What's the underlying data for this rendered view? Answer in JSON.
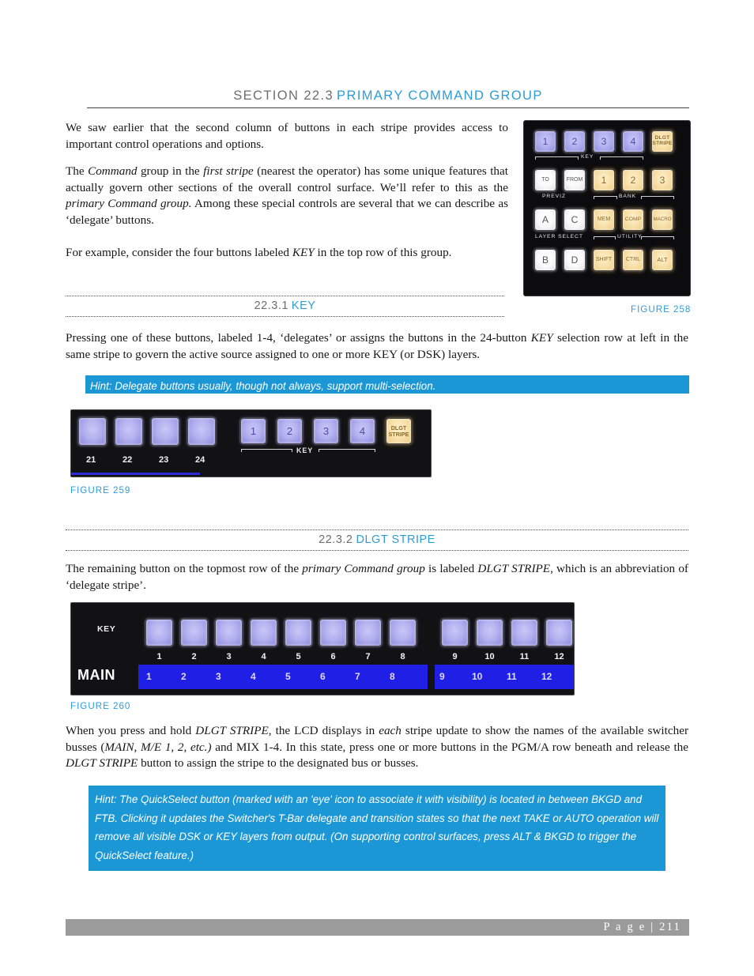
{
  "header": {
    "section_number": "SECTION 22.3",
    "section_title": "PRIMARY COMMAND GROUP"
  },
  "paragraphs": {
    "p1": "We saw earlier that the second column of buttons in each stripe provides access to important control operations and options.",
    "p2_a": "The ",
    "p2_i1": "Command",
    "p2_b": " group in the ",
    "p2_i2": "first stripe",
    "p2_c": " (nearest the operator) has some unique features that actually govern other sections of the overall control surface. We’ll refer to this as the ",
    "p2_i3": "primary Command group.",
    "p2_d": " Among these special controls are several that we can describe as ‘delegate’ buttons.",
    "p3_a": "For example, consider the four buttons labeled ",
    "p3_i1": "KEY",
    "p3_b": " in the top row of this group.",
    "p4_a": "Pressing one of these buttons, labeled 1-4, ‘delegates’ or assigns the buttons in the 24-button ",
    "p4_i1": "KEY",
    "p4_b": " selection row at left in the same stripe  to govern the active source assigned to one or more KEY (or DSK) layers.",
    "p5_a": "The remaining button on the topmost row of the ",
    "p5_i1": "primary Command group",
    "p5_b": " is labeled ",
    "p5_i2": "DLGT STRIPE",
    "p5_c": ", which is an abbreviation of ‘delegate stripe’.",
    "p6_a": "When you press and hold ",
    "p6_i1": "DLGT STRIPE",
    "p6_b": ", the LCD displays in ",
    "p6_i2": "each",
    "p6_c": " stripe update to show the names of the available switcher busses (",
    "p6_i3": "MAIN, M/E 1, 2,  etc.)",
    "p6_d": " and MIX 1-4.  In this state, press one or more buttons in the PGM/A row beneath and release the ",
    "p6_i4": "DLGT STRIPE",
    "p6_e": " button to assign the stripe to the designated bus or busses."
  },
  "subsections": [
    {
      "number": "22.3.1",
      "title": "KEY"
    },
    {
      "number": "22.3.2",
      "title": "DLGT STRIPE"
    }
  ],
  "hints": {
    "hint1": "Hint: Delegate buttons usually, though not always, support multi-selection.",
    "hint2": "Hint:  The QuickSelect button (marked with an 'eye' icon to associate it with visibility) is located in between BKGD and FTB. Clicking it updates the Switcher's T-Bar delegate and transition states so that the next TAKE or AUTO operation will remove all visible DSK or KEY layers from output. (On supporting control surfaces, press ALT & BKGD to trigger the QuickSelect feature.)"
  },
  "figure_captions": {
    "fig258": "FIGURE 258",
    "fig259": "FIGURE 259",
    "fig260": "FIGURE 260"
  },
  "figure258": {
    "row1": [
      {
        "label": "1",
        "lamp": "blue"
      },
      {
        "label": "2",
        "lamp": "blue"
      },
      {
        "label": "3",
        "lamp": "blue"
      },
      {
        "label": "4",
        "lamp": "blue"
      },
      {
        "label": "DLGT STRIPE",
        "lamp": "amber"
      }
    ],
    "row1_group_label": "KEY",
    "row2": [
      {
        "label": "TO",
        "lamp": "white"
      },
      {
        "label": "FROM",
        "lamp": "white"
      },
      {
        "label": "1",
        "lamp": "amber"
      },
      {
        "label": "2",
        "lamp": "amber"
      },
      {
        "label": "3",
        "lamp": "amber"
      }
    ],
    "row2_group_label_left": "PREVIZ",
    "row2_group_label_right": "BANK",
    "row3": [
      {
        "label": "A",
        "lamp": "white"
      },
      {
        "label": "C",
        "lamp": "white"
      },
      {
        "label": "MEM",
        "lamp": "amber"
      },
      {
        "label": "COMP",
        "lamp": "amber"
      },
      {
        "label": "MACRO",
        "lamp": "amber"
      }
    ],
    "row3_group_label_left": "LAYER SELECT",
    "row3_group_label_right": "UTILITY",
    "row4": [
      {
        "label": "B",
        "lamp": "white"
      },
      {
        "label": "D",
        "lamp": "white"
      },
      {
        "label": "SHIFT",
        "lamp": "amber"
      },
      {
        "label": "CTRL",
        "lamp": "amber"
      },
      {
        "label": "ALT",
        "lamp": "amber"
      }
    ]
  },
  "figure259": {
    "source_buttons": [
      {
        "label": "",
        "number": "21",
        "lamp": "blue"
      },
      {
        "label": "",
        "number": "22",
        "lamp": "blue"
      },
      {
        "label": "",
        "number": "23",
        "lamp": "blue"
      },
      {
        "label": "",
        "number": "24",
        "lamp": "blue"
      }
    ],
    "key_buttons": [
      {
        "label": "1",
        "lamp": "blue"
      },
      {
        "label": "2",
        "lamp": "blue"
      },
      {
        "label": "3",
        "lamp": "blue"
      },
      {
        "label": "4",
        "lamp": "blue"
      },
      {
        "label": "DLGT STRIPE",
        "lamp": "amber"
      }
    ],
    "group_label": "KEY"
  },
  "figure260": {
    "row_label": "KEY",
    "bus_label": "MAIN",
    "buttons_left": [
      {
        "number": "1",
        "lamp": "blue",
        "lcd": "1"
      },
      {
        "number": "2",
        "lamp": "blue",
        "lcd": "2"
      },
      {
        "number": "3",
        "lamp": "blue",
        "lcd": "3"
      },
      {
        "number": "4",
        "lamp": "blue",
        "lcd": "4"
      },
      {
        "number": "5",
        "lamp": "blue",
        "lcd": "5"
      },
      {
        "number": "6",
        "lamp": "blue",
        "lcd": "6"
      },
      {
        "number": "7",
        "lamp": "blue",
        "lcd": "7"
      },
      {
        "number": "8",
        "lamp": "blue",
        "lcd": "8"
      }
    ],
    "buttons_right": [
      {
        "number": "9",
        "lamp": "blue",
        "lcd": "9"
      },
      {
        "number": "10",
        "lamp": "blue",
        "lcd": "10"
      },
      {
        "number": "11",
        "lamp": "blue",
        "lcd": "11"
      },
      {
        "number": "12",
        "lamp": "blue",
        "lcd": "12"
      }
    ]
  },
  "footer": {
    "page_text": "P a g e  | 211"
  },
  "colors": {
    "accent_blue": "#2e9bd6",
    "hint_bg": "#1b97d6",
    "footer_bg": "#9b9b9b",
    "lcd_blue": "#1f1fe6"
  }
}
